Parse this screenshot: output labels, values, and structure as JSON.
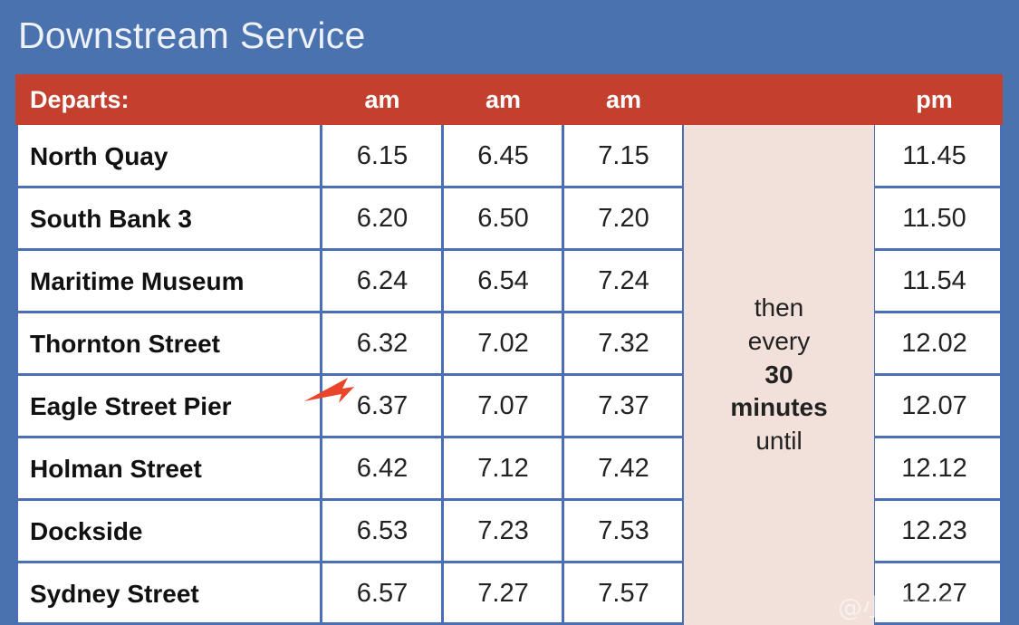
{
  "title": "Downstream Service",
  "colors": {
    "background_blue": "#4a72ae",
    "header_red": "#c2402d",
    "grid_blue": "#4a6fb4",
    "pink_block": "#f2e0da",
    "arrow_orange": "#e8452a",
    "cell_white": "#ffffff"
  },
  "table": {
    "headers": {
      "departs": "Departs:",
      "am1": "am",
      "am2": "am",
      "am3": "am",
      "pm": "pm"
    },
    "note_block": {
      "line1": "then",
      "line2": "every",
      "line3": "30",
      "line4": "minutes",
      "line5": "until"
    },
    "rows": [
      {
        "station": "North Quay",
        "t0": "6.15",
        "t1": "6.45",
        "t2": "7.15",
        "t3": "11.45"
      },
      {
        "station": "South Bank 3",
        "t0": "6.20",
        "t1": "6.50",
        "t2": "7.20",
        "t3": "11.50"
      },
      {
        "station": "Maritime Museum",
        "t0": "6.24",
        "t1": "6.54",
        "t2": "7.24",
        "t3": "11.54"
      },
      {
        "station": "Thornton Street",
        "t0": "6.32",
        "t1": "7.02",
        "t2": "7.32",
        "t3": "12.02"
      },
      {
        "station": "Eagle Street Pier",
        "t0": "6.37",
        "t1": "7.07",
        "t2": "7.37",
        "t3": "12.07"
      },
      {
        "station": "Holman Street",
        "t0": "6.42",
        "t1": "7.12",
        "t2": "7.42",
        "t3": "12.12"
      },
      {
        "station": "Dockside",
        "t0": "6.53",
        "t1": "7.23",
        "t2": "7.53",
        "t3": "12.23"
      },
      {
        "station": "Sydney Street",
        "t0": "6.57",
        "t1": "7.27",
        "t2": "7.57",
        "t3": "12.27"
      }
    ]
  },
  "annotation": {
    "arrow_icon": "arrow-up-left-icon",
    "points_at_row": "Eagle Street Pier"
  },
  "watermark": "@小学校之家"
}
